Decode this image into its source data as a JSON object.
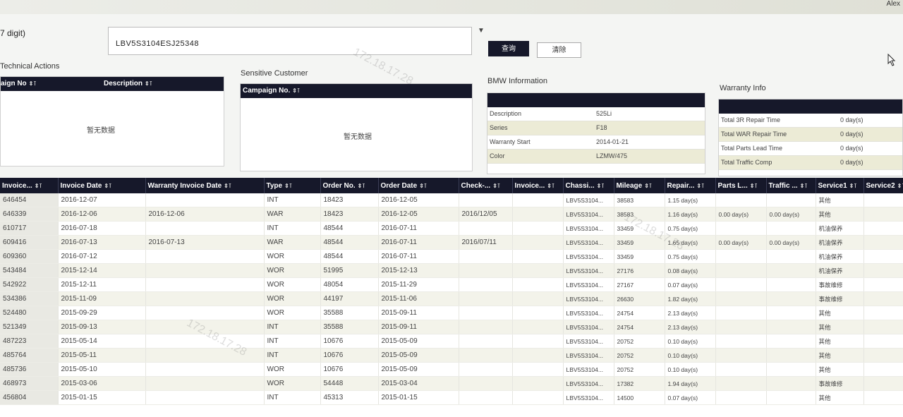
{
  "header": {
    "user_fragment": "Alex"
  },
  "vin": {
    "label": "7 digit)",
    "value": "LBV5S3104ESJ25348",
    "search_label": "查询",
    "clear_label": "清除"
  },
  "technical_actions": {
    "title": "Technical Actions",
    "col1": "aign No",
    "col2": "Description",
    "empty": "暂无数据"
  },
  "sensitive_customer": {
    "title": "Sensitive Customer",
    "col1": "Campaign No.",
    "empty": "暂无数据"
  },
  "bmw_info": {
    "title": "BMW Information",
    "rows": [
      {
        "k": "Description",
        "v": "525Li"
      },
      {
        "k": "Series",
        "v": "F18"
      },
      {
        "k": "Warranty Start",
        "v": "2014-01-21"
      },
      {
        "k": "Color",
        "v": "LZMW/475"
      }
    ]
  },
  "warranty_info": {
    "title": "Warranty Info",
    "rows": [
      {
        "k": "Total 3R Repair Time",
        "v": "0 day(s)"
      },
      {
        "k": "Total WAR Repair Time",
        "v": "0 day(s)"
      },
      {
        "k": "Total Parts Lead Time",
        "v": "0 day(s)"
      },
      {
        "k": "Total Traffic Comp",
        "v": "0 day(s)"
      }
    ]
  },
  "grid": {
    "columns": [
      "Invoice...",
      "Invoice Date",
      "Warranty Invoice Date",
      "Type",
      "Order No.",
      "Order Date",
      "Check-...",
      "Invoice...",
      "Chassi...",
      "Mileage",
      "Repair...",
      "Parts L...",
      "Traffic ...",
      "Service1",
      "Service2"
    ],
    "rows": [
      [
        "646454",
        "2016-12-07",
        "",
        "INT",
        "18423",
        "2016-12-05",
        "",
        "",
        "LBV5S3104...",
        "38583",
        "1.15 day(s)",
        "",
        "",
        "其他",
        ""
      ],
      [
        "646339",
        "2016-12-06",
        "2016-12-06",
        "WAR",
        "18423",
        "2016-12-05",
        "2016/12/05",
        "",
        "LBV5S3104...",
        "38583",
        "1.16 day(s)",
        "0.00 day(s)",
        "0.00 day(s)",
        "其他",
        ""
      ],
      [
        "610717",
        "2016-07-18",
        "",
        "INT",
        "48544",
        "2016-07-11",
        "",
        "",
        "LBV5S3104...",
        "33459",
        "0.75 day(s)",
        "",
        "",
        "机油保养",
        ""
      ],
      [
        "609416",
        "2016-07-13",
        "2016-07-13",
        "WAR",
        "48544",
        "2016-07-11",
        "2016/07/11",
        "",
        "LBV5S3104...",
        "33459",
        "1.65 day(s)",
        "0.00 day(s)",
        "0.00 day(s)",
        "机油保养",
        ""
      ],
      [
        "609360",
        "2016-07-12",
        "",
        "WOR",
        "48544",
        "2016-07-11",
        "",
        "",
        "LBV5S3104...",
        "33459",
        "0.75 day(s)",
        "",
        "",
        "机油保养",
        ""
      ],
      [
        "543484",
        "2015-12-14",
        "",
        "WOR",
        "51995",
        "2015-12-13",
        "",
        "",
        "LBV5S3104...",
        "27176",
        "0.08 day(s)",
        "",
        "",
        "机油保养",
        ""
      ],
      [
        "542922",
        "2015-12-11",
        "",
        "WOR",
        "48054",
        "2015-11-29",
        "",
        "",
        "LBV5S3104...",
        "27167",
        "0.07 day(s)",
        "",
        "",
        "事故维修",
        ""
      ],
      [
        "534386",
        "2015-11-09",
        "",
        "WOR",
        "44197",
        "2015-11-06",
        "",
        "",
        "LBV5S3104...",
        "26630",
        "1.82 day(s)",
        "",
        "",
        "事故维修",
        ""
      ],
      [
        "524480",
        "2015-09-29",
        "",
        "WOR",
        "35588",
        "2015-09-11",
        "",
        "",
        "LBV5S3104...",
        "24754",
        "2.13 day(s)",
        "",
        "",
        "其他",
        ""
      ],
      [
        "521349",
        "2015-09-13",
        "",
        "INT",
        "35588",
        "2015-09-11",
        "",
        "",
        "LBV5S3104...",
        "24754",
        "2.13 day(s)",
        "",
        "",
        "其他",
        ""
      ],
      [
        "487223",
        "2015-05-14",
        "",
        "INT",
        "10676",
        "2015-05-09",
        "",
        "",
        "LBV5S3104...",
        "20752",
        "0.10 day(s)",
        "",
        "",
        "其他",
        ""
      ],
      [
        "485764",
        "2015-05-11",
        "",
        "INT",
        "10676",
        "2015-05-09",
        "",
        "",
        "LBV5S3104...",
        "20752",
        "0.10 day(s)",
        "",
        "",
        "其他",
        ""
      ],
      [
        "485736",
        "2015-05-10",
        "",
        "WOR",
        "10676",
        "2015-05-09",
        "",
        "",
        "LBV5S3104...",
        "20752",
        "0.10 day(s)",
        "",
        "",
        "其他",
        ""
      ],
      [
        "468973",
        "2015-03-06",
        "",
        "WOR",
        "54448",
        "2015-03-04",
        "",
        "",
        "LBV5S3104...",
        "17382",
        "1.94 day(s)",
        "",
        "",
        "事故维修",
        ""
      ],
      [
        "456804",
        "2015-01-15",
        "",
        "INT",
        "45313",
        "2015-01-15",
        "",
        "",
        "LBV5S3104...",
        "14500",
        "0.07 day(s)",
        "",
        "",
        "其他",
        ""
      ]
    ]
  },
  "watermark": "172.18.17.28"
}
